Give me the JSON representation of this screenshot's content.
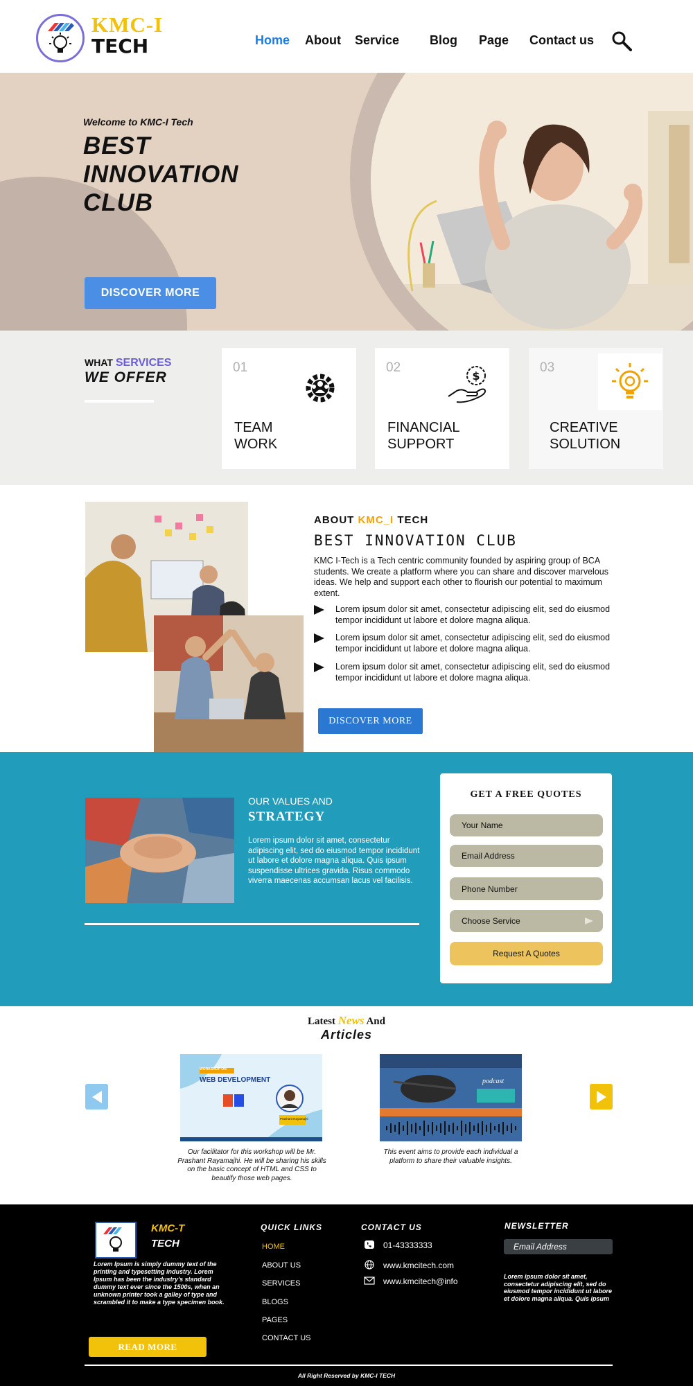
{
  "brand": {
    "line1": "KMC-I",
    "line2": "TECH"
  },
  "nav": {
    "items": [
      "Home",
      "About",
      "Service",
      "Blog",
      "Page",
      "Contact us"
    ],
    "active": "Home"
  },
  "hero": {
    "welcome": "Welcome to KMC-I Tech",
    "title": "BEST INNOVATION CLUB",
    "button": "DISCOVER MORE"
  },
  "services": {
    "heading_prefix": "WHAT",
    "heading_highlight": "SERVICES",
    "heading_line2": "WE OFFER",
    "cards": [
      {
        "num": "01",
        "label": "TEAM WORK",
        "icon": "gears-team-icon"
      },
      {
        "num": "02",
        "label": "FINANCIAL SUPPORT",
        "icon": "money-hand-icon"
      },
      {
        "num": "03",
        "label": "CREATIVE SOLUTION",
        "icon": "lightbulb-icon"
      }
    ]
  },
  "about": {
    "heading_prefix": "ABOUT",
    "heading_highlight": "KMC_I",
    "heading_suffix": "TECH",
    "subtitle": "BEST INNOVATION CLUB",
    "paragraph": "KMC I-Tech is a Tech centric community founded by aspiring group of BCA students. We create a platform where you can share and discover marvelous ideas. We help and support each other to flourish our potential to maximum extent.",
    "bullets": [
      "Lorem ipsum dolor sit amet, consectetur adipiscing elit, sed do eiusmod tempor incididunt ut labore et dolore magna aliqua.",
      "Lorem ipsum dolor sit amet, consectetur adipiscing elit, sed do eiusmod tempor incididunt ut labore et dolore magna aliqua.",
      "Lorem ipsum dolor sit amet, consectetur adipiscing elit, sed do eiusmod tempor incididunt ut labore et dolore magna aliqua."
    ],
    "button": "DISCOVER MORE"
  },
  "values": {
    "heading1": "OUR VALUES AND",
    "heading2": "STRATEGY",
    "paragraph": "Lorem ipsum dolor sit amet, consectetur adipiscing elit, sed do eiusmod tempor incididunt ut labore et dolore magna aliqua. Quis ipsum suspendisse ultrices gravida. Risus commodo viverra maecenas accumsan lacus vel facilisis."
  },
  "quote": {
    "title": "GET A FREE QUOTES",
    "fields": [
      "Your Name",
      "Email Address",
      "Phone Number"
    ],
    "select": "Choose Service",
    "button": "Request A Quotes"
  },
  "news": {
    "heading_prefix": "Latest",
    "heading_highlight": "News",
    "heading_suffix": "And",
    "heading_line2": "Articles",
    "cards": [
      {
        "badge": "WORKSHOP ON",
        "title": "WEB DEVELOPMENT",
        "person": "Prashant Rayamajhi",
        "caption": "Our facilitator for this workshop will be Mr. Prashant Rayamajhi. He will be sharing his skills on the basic concept of HTML and CSS to beautify those web pages."
      },
      {
        "badge": "podcast",
        "caption": "This event aims to provide each individual a platform to share their valuable insights."
      }
    ]
  },
  "footer": {
    "brand1": "KMC-T",
    "brand2": "TECH",
    "about": "Lorem Ipsum is simply dummy text of the printing and typesetting industry. Lorem Ipsum has been the industry's standard dummy text ever since the 1500s, when an unknown printer took a galley of type and scrambled it to make a type specimen book.",
    "read_more": "READ MORE",
    "quick_links_title": "QUICK LINKS",
    "quick_links": [
      "HOME",
      "ABOUT US",
      "SERVICES",
      "BLOGS",
      "PAGES",
      "CONTACT US"
    ],
    "contact_title": "CONTACT US",
    "phone": "01-43333333",
    "website": "www.kmcitech.com",
    "email": "www.kmcitech@info",
    "newsletter_title": "NEWSLETTER",
    "newsletter_placeholder": "Email Address",
    "newsletter_text": "Lorem ipsum dolor sit amet, consectetur adipiscing elit, sed do eiusmod tempor incididunt ut labore et dolore magna aliqua. Quis ipsum",
    "copyright": "All Right Reserved by KMC-I TECH"
  },
  "colors": {
    "accent_yellow": "#f2c10a",
    "accent_blue": "#1a7ce6",
    "hero_bg": "#e3d1c2",
    "values_bg": "#219dbb",
    "footer_bg": "#000000"
  }
}
